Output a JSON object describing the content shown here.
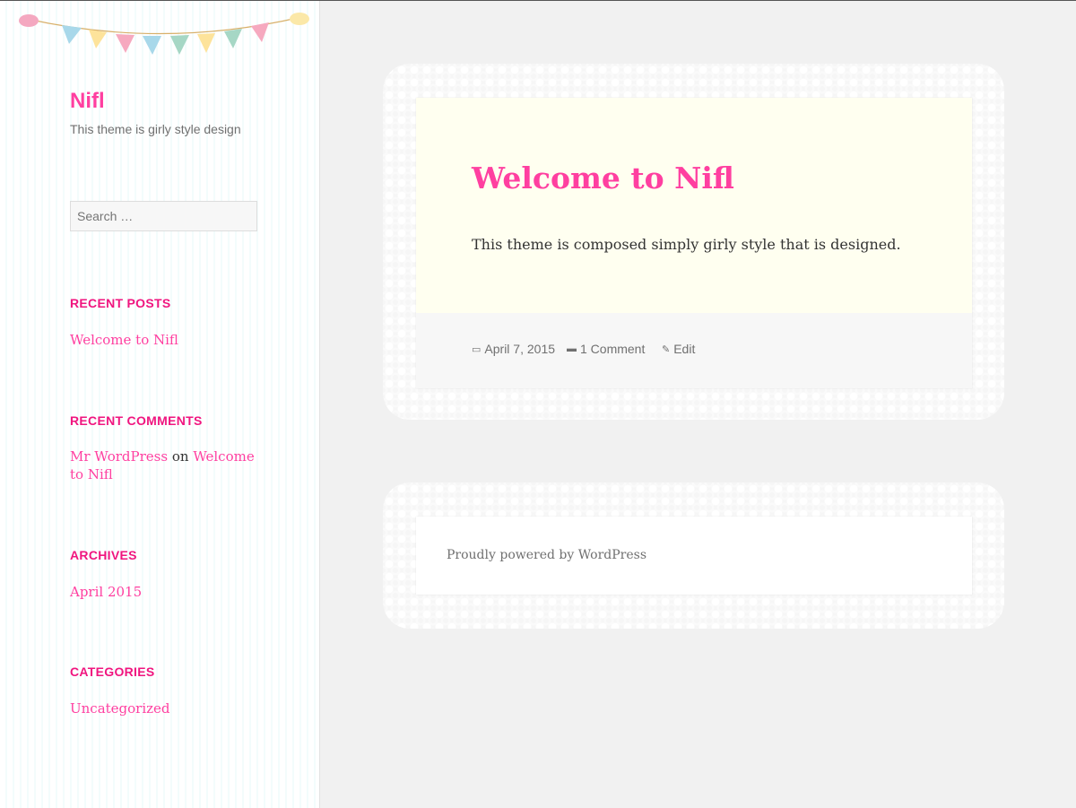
{
  "site": {
    "title": "Nifl",
    "tagline": "This theme is girly style design"
  },
  "search": {
    "placeholder": "Search …"
  },
  "widgets": {
    "recent_posts": {
      "title": "RECENT POSTS",
      "items": [
        "Welcome to Nifl"
      ]
    },
    "recent_comments": {
      "title": "RECENT COMMENTS",
      "author": "Mr WordPress",
      "on": "on",
      "post": "Welcome to Nifl"
    },
    "archives": {
      "title": "ARCHIVES",
      "items": [
        "April 2015"
      ]
    },
    "categories": {
      "title": "CATEGORIES",
      "items": [
        "Uncategorized"
      ]
    }
  },
  "post": {
    "title": "Welcome to Nifl",
    "body": "This theme is composed simply girly style that is designed.",
    "date": "April 7, 2015",
    "comments": "1 Comment",
    "edit": "Edit"
  },
  "footer": {
    "text": "Proudly powered by WordPress"
  },
  "colors": {
    "accent": "#ff3fa0",
    "widget_title": "#f0157f"
  }
}
